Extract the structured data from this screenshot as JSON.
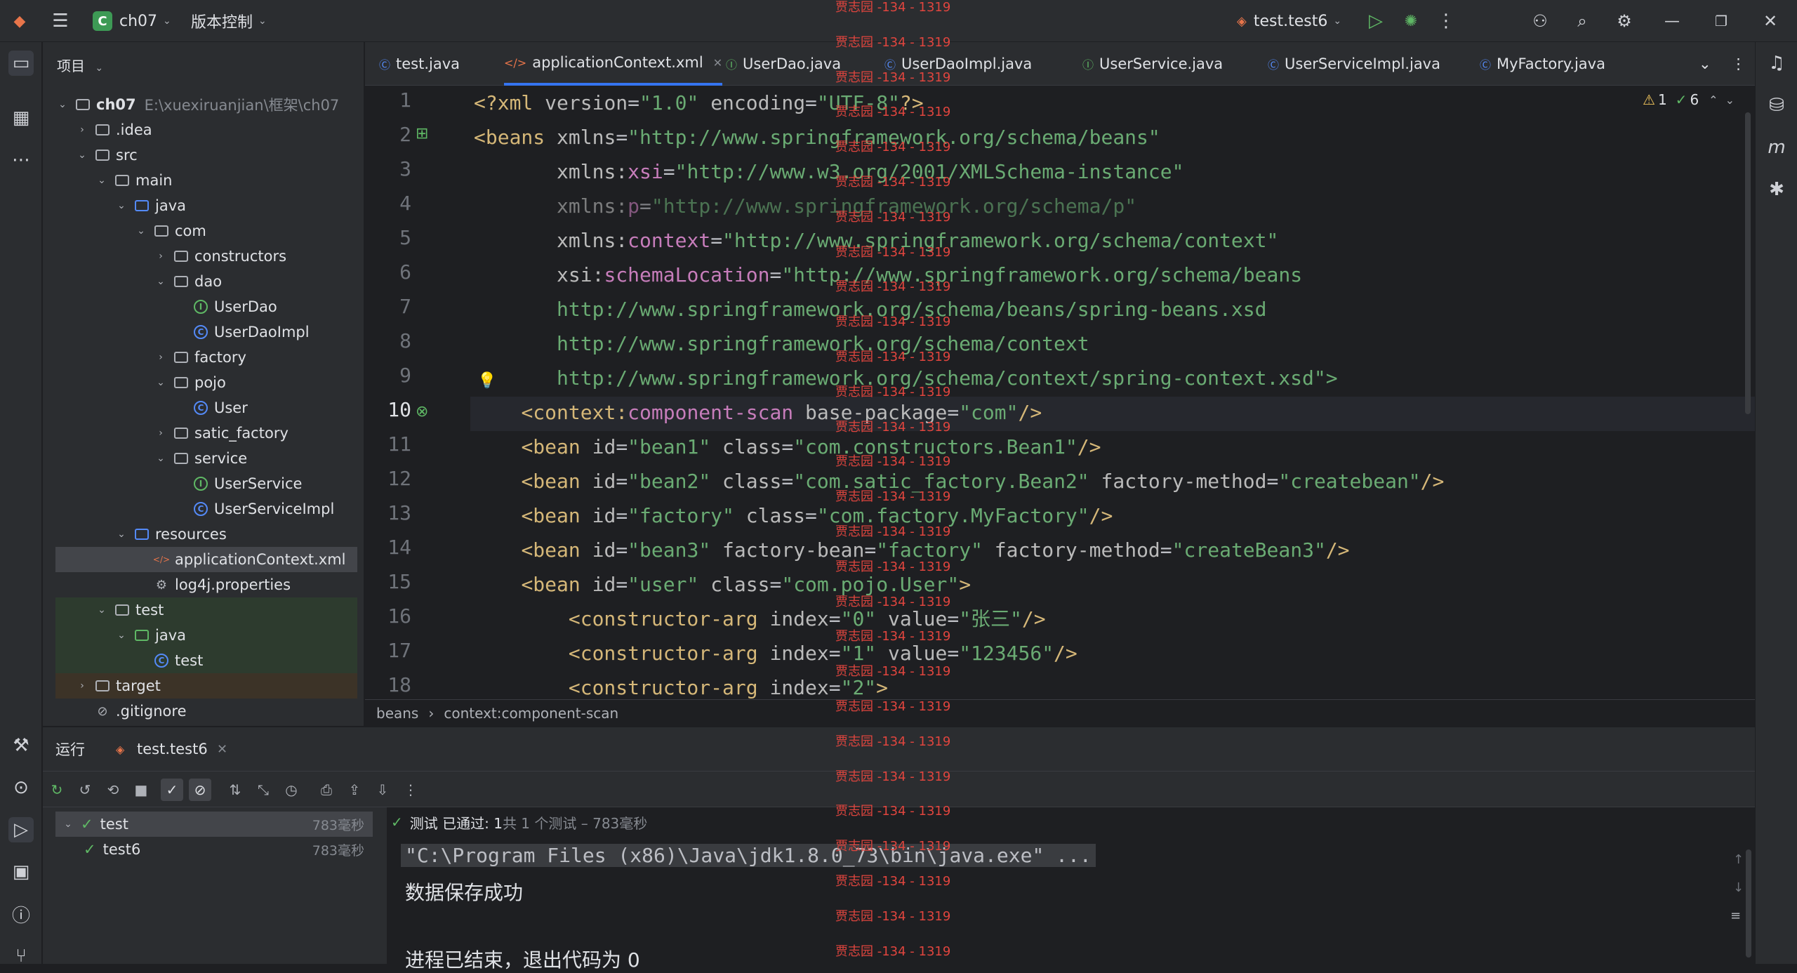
{
  "titlebar": {
    "project": "ch07",
    "project_badge": "C",
    "vcs": "版本控制",
    "run_config": "test.test6"
  },
  "project_panel": {
    "title": "项目"
  },
  "tree": [
    {
      "label": "ch07",
      "extra": "E:\\xuexiruanjian\\框架\\ch07",
      "depth": 0,
      "type": "module",
      "open": true
    },
    {
      "label": ".idea",
      "depth": 1,
      "type": "folder",
      "open": false
    },
    {
      "label": "src",
      "depth": 1,
      "type": "folder",
      "open": true
    },
    {
      "label": "main",
      "depth": 2,
      "type": "folder",
      "open": true
    },
    {
      "label": "java",
      "depth": 3,
      "type": "srcfolder",
      "open": true
    },
    {
      "label": "com",
      "depth": 4,
      "type": "package",
      "open": true
    },
    {
      "label": "constructors",
      "depth": 5,
      "type": "package",
      "open": false
    },
    {
      "label": "dao",
      "depth": 5,
      "type": "package",
      "open": true
    },
    {
      "label": "UserDao",
      "depth": 6,
      "type": "interface"
    },
    {
      "label": "UserDaoImpl",
      "depth": 6,
      "type": "class"
    },
    {
      "label": "factory",
      "depth": 5,
      "type": "package",
      "open": false
    },
    {
      "label": "pojo",
      "depth": 5,
      "type": "package",
      "open": true
    },
    {
      "label": "User",
      "depth": 6,
      "type": "class"
    },
    {
      "label": "satic_factory",
      "depth": 5,
      "type": "package",
      "open": false
    },
    {
      "label": "service",
      "depth": 5,
      "type": "package",
      "open": true
    },
    {
      "label": "UserService",
      "depth": 6,
      "type": "interface"
    },
    {
      "label": "UserServiceImpl",
      "depth": 6,
      "type": "class"
    },
    {
      "label": "resources",
      "depth": 3,
      "type": "resfolder",
      "open": true
    },
    {
      "label": "applicationContext.xml",
      "depth": 4,
      "type": "xml",
      "selected": true
    },
    {
      "label": "log4j.properties",
      "depth": 4,
      "type": "props"
    },
    {
      "label": "test",
      "depth": 2,
      "type": "folder",
      "open": true,
      "bg": "test"
    },
    {
      "label": "java",
      "depth": 3,
      "type": "testfolder",
      "open": true,
      "bg": "test"
    },
    {
      "label": "test",
      "depth": 4,
      "type": "class",
      "bg": "test"
    },
    {
      "label": "target",
      "depth": 1,
      "type": "folder",
      "open": false,
      "bg": "target"
    },
    {
      "label": ".gitignore",
      "depth": 1,
      "type": "ignore"
    }
  ],
  "tabs": [
    "test.java",
    "applicationContext.xml",
    "UserDao.java",
    "UserDaoImpl.java",
    "UserService.java",
    "UserServiceImpl.java",
    "MyFactory.java"
  ],
  "inspection": {
    "warnings": "1",
    "ok": "6"
  },
  "line_numbers": [
    "1",
    "2",
    "3",
    "4",
    "5",
    "6",
    "7",
    "8",
    "9",
    "10",
    "11",
    "12",
    "13",
    "14",
    "15",
    "16",
    "17",
    "18"
  ],
  "code_lines": [
    "<?xml version=\"1.0\" encoding=\"UTF-8\"?>",
    "<beans xmlns=\"http://www.springframework.org/schema/beans\"",
    "       xmlns:xsi=\"http://www.w3.org/2001/XMLSchema-instance\"",
    "       xmlns:p=\"http://www.springframework.org/schema/p\"",
    "       xmlns:context=\"http://www.springframework.org/schema/context\"",
    "       xsi:schemaLocation=\"http://www.springframework.org/schema/beans",
    "       http://www.springframework.org/schema/beans/spring-beans.xsd",
    "       http://www.springframework.org/schema/context",
    "       http://www.springframework.org/schema/context/spring-context.xsd\">",
    "    <context:component-scan base-package=\"com\"/>",
    "    <bean id=\"bean1\" class=\"com.constructors.Bean1\"/>",
    "    <bean id=\"bean2\" class=\"com.satic_factory.Bean2\" factory-method=\"createbean\"/>",
    "    <bean id=\"factory\" class=\"com.factory.MyFactory\"/>",
    "    <bean id=\"bean3\" factory-bean=\"factory\" factory-method=\"createBean3\"/>",
    "    <bean id=\"user\" class=\"com.pojo.User\">",
    "        <constructor-arg index=\"0\" value=\"张三\"/>",
    "        <constructor-arg index=\"1\" value=\"123456\"/>",
    "        <constructor-arg index=\"2\">"
  ],
  "breadcrumb": [
    "beans",
    "context:component-scan"
  ],
  "run": {
    "tab_label": "运行",
    "config_tab": "test.test6",
    "tests": [
      {
        "name": "test",
        "time": "783毫秒"
      },
      {
        "name": "test6",
        "time": "783毫秒"
      }
    ],
    "status_prefix": "测试 已通过: 1",
    "status_suffix": "共 1 个测试 – 783毫秒",
    "console": [
      "\"C:\\Program Files (x86)\\Java\\jdk1.8.0_73\\bin\\java.exe\" ...",
      "数据保存成功",
      "",
      "进程已结束，退出代码为 0"
    ]
  },
  "watermark": "贾志园 -134 - 1319"
}
